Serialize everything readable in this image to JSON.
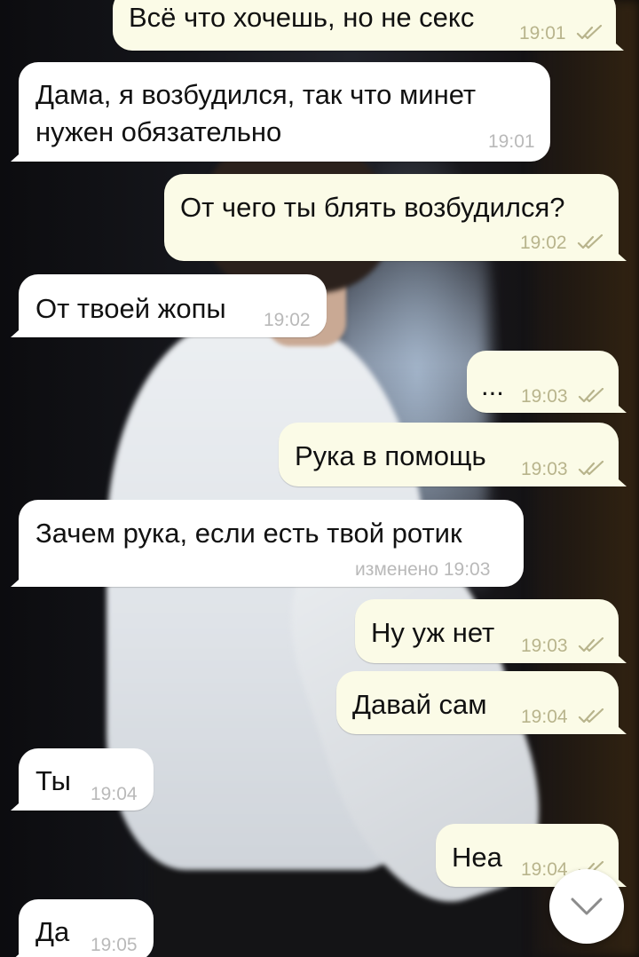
{
  "messages": [
    {
      "direction": "out",
      "text": "Всё что хочешь, но не секс",
      "time": "19:01",
      "read": true
    },
    {
      "direction": "in",
      "text_lines": [
        "Дама, я возбудился, так что минет",
        "нужен обязательно"
      ],
      "time": "19:01"
    },
    {
      "direction": "out",
      "text": "От чего ты блять возбудился?",
      "time": "19:02",
      "read": true
    },
    {
      "direction": "in",
      "text": "От твоей жопы",
      "time": "19:02"
    },
    {
      "direction": "out",
      "text": "...",
      "time": "19:03",
      "read": true
    },
    {
      "direction": "out",
      "text": "Рука в помощь",
      "time": "19:03",
      "read": true
    },
    {
      "direction": "in",
      "text": "Зачем рука, если есть твой ротик",
      "time": "изменено 19:03"
    },
    {
      "direction": "out",
      "text": "Ну уж нет",
      "time": "19:03",
      "read": true
    },
    {
      "direction": "out",
      "text": "Давай сам",
      "time": "19:04",
      "read": true
    },
    {
      "direction": "in",
      "text": "Ты",
      "time": "19:04"
    },
    {
      "direction": "out",
      "text": "Неа",
      "time": "19:04",
      "read": true
    },
    {
      "direction": "in",
      "text": "Да",
      "time": "19:05"
    }
  ],
  "icons": {
    "read_receipt": "double-check-icon",
    "scroll_down": "chevron-down-icon"
  },
  "colors": {
    "incoming_bubble": "#ffffff",
    "outgoing_bubble": "#fbfbe7",
    "outgoing_meta": "#b8b48c",
    "incoming_meta": "#b9b9b9"
  }
}
